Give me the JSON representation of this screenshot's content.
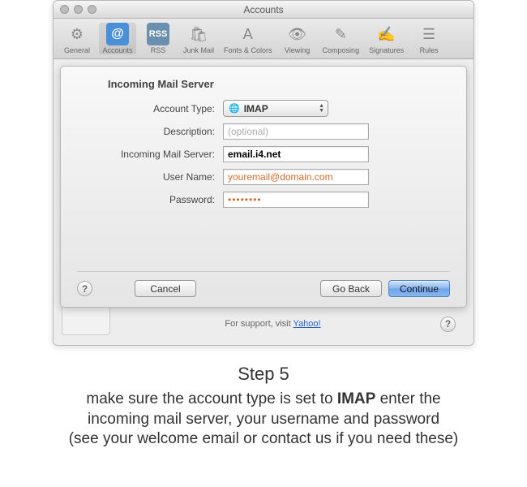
{
  "window": {
    "title": "Accounts"
  },
  "toolbar": {
    "items": [
      {
        "label": "General"
      },
      {
        "label": "Accounts"
      },
      {
        "label": "RSS"
      },
      {
        "label": "Junk Mail"
      },
      {
        "label": "Fonts & Colors"
      },
      {
        "label": "Viewing"
      },
      {
        "label": "Composing"
      },
      {
        "label": "Signatures"
      },
      {
        "label": "Rules"
      }
    ]
  },
  "sheet": {
    "title": "Incoming Mail Server",
    "labels": {
      "account_type": "Account Type:",
      "description": "Description:",
      "incoming_server": "Incoming Mail Server:",
      "user_name": "User Name:",
      "password": "Password:"
    },
    "values": {
      "account_type": "IMAP",
      "description_placeholder": "(optional)",
      "incoming_server": "email.i4.net",
      "user_name": "youremail@domain.com",
      "password": "••••••••"
    },
    "buttons": {
      "cancel": "Cancel",
      "go_back": "Go Back",
      "continue": "Continue"
    }
  },
  "footer": {
    "support_prefix": "For support, visit ",
    "support_link": "Yahoo!"
  },
  "caption": {
    "step": "Step 5",
    "line1a": "make sure the account type is set to ",
    "line1b": "IMAP",
    "line1c": "  enter the",
    "line2": "incoming mail server, your username and password",
    "line3": "(see your welcome email or contact us if you need these)"
  }
}
